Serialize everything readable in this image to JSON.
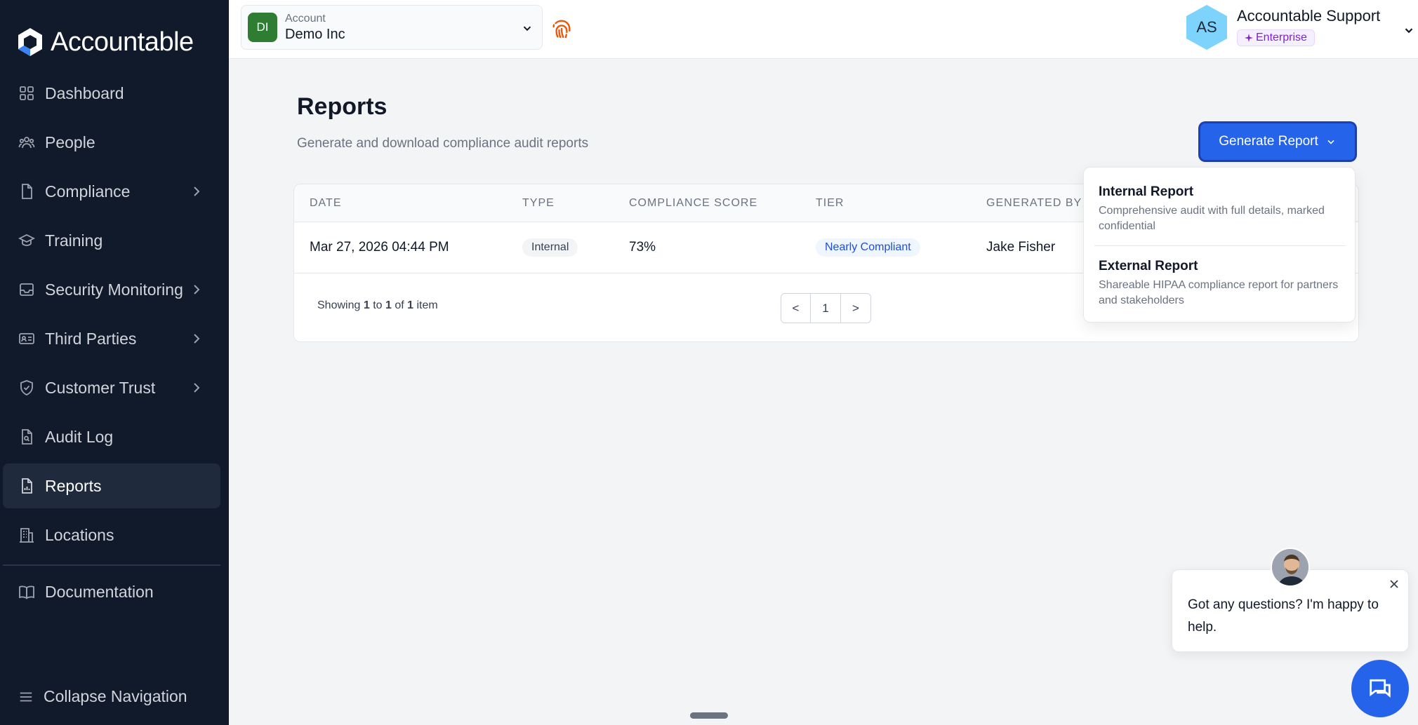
{
  "brand": {
    "name": "Accountable"
  },
  "sidebar": {
    "items": [
      {
        "label": "Dashboard",
        "icon": "grid-icon"
      },
      {
        "label": "People",
        "icon": "people-icon"
      },
      {
        "label": "Compliance",
        "icon": "document-icon"
      },
      {
        "label": "Training",
        "icon": "graduation-cap-icon"
      },
      {
        "label": "Security Monitoring",
        "icon": "inbox-icon"
      },
      {
        "label": "Third Parties",
        "icon": "id-card-icon"
      },
      {
        "label": "Customer Trust",
        "icon": "shield-check-icon"
      },
      {
        "label": "Audit Log",
        "icon": "file-search-icon"
      },
      {
        "label": "Reports",
        "icon": "file-chart-icon"
      },
      {
        "label": "Locations",
        "icon": "building-icon"
      }
    ],
    "documentation": "Documentation",
    "collapse": "Collapse Navigation"
  },
  "topbar": {
    "account_label": "Account",
    "account_name": "Demo Inc",
    "account_initials": "DI",
    "user_initials": "AS",
    "user_name": "Accountable Support",
    "plan": "Enterprise"
  },
  "page": {
    "title": "Reports",
    "subtitle": "Generate and download compliance audit reports",
    "generate_button": "Generate Report"
  },
  "table": {
    "columns": [
      "DATE",
      "TYPE",
      "COMPLIANCE SCORE",
      "TIER",
      "GENERATED BY"
    ],
    "rows": [
      {
        "date": "Mar 27, 2026 04:44 PM",
        "type": "Internal",
        "score": "73%",
        "tier": "Nearly Compliant",
        "generated_by": "Jake Fisher"
      }
    ],
    "pagination": {
      "showing_prefix": "Showing",
      "from": "1",
      "to_word": "to",
      "to": "1",
      "of_word": "of",
      "total": "1",
      "suffix": "item",
      "prev": "<",
      "page": "1",
      "next": ">"
    }
  },
  "dropdown": {
    "items": [
      {
        "title": "Internal Report",
        "description": "Comprehensive audit with full details, marked confidential"
      },
      {
        "title": "External Report",
        "description": "Shareable HIPAA compliance report for partners and stakeholders"
      }
    ]
  },
  "chat": {
    "message": "Got any questions? I'm happy to help."
  },
  "colors": {
    "sidebar_bg": "#111a2b",
    "accent": "#2563eb",
    "account_green": "#2e7d32",
    "fingerprint": "#ea580c",
    "plan_purple": "#7e22ce"
  }
}
